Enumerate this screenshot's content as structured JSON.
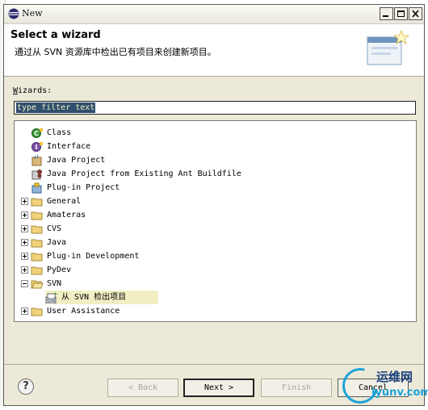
{
  "window": {
    "title": "New"
  },
  "header": {
    "title": "Select a wizard",
    "description": "通过从 SVN 资源库中检出已有项目来创建新项目。"
  },
  "wizards_label": {
    "mnemonic": "W",
    "rest": "izards:"
  },
  "filter": {
    "value": "type filter text"
  },
  "tree": {
    "items": [
      {
        "label": "Class",
        "icon": "class-icon",
        "kind": "leaf"
      },
      {
        "label": "Interface",
        "icon": "interface-icon",
        "kind": "leaf"
      },
      {
        "label": "Java Project",
        "icon": "java-project-icon",
        "kind": "leaf"
      },
      {
        "label": "Java Project from Existing Ant Buildfile",
        "icon": "ant-buildfile-icon",
        "kind": "leaf"
      },
      {
        "label": "Plug-in Project",
        "icon": "plugin-project-icon",
        "kind": "leaf"
      },
      {
        "label": "General",
        "icon": "folder-icon",
        "kind": "collapsed"
      },
      {
        "label": "Amateras",
        "icon": "folder-icon",
        "kind": "collapsed"
      },
      {
        "label": "CVS",
        "icon": "folder-icon",
        "kind": "collapsed"
      },
      {
        "label": "Java",
        "icon": "folder-icon",
        "kind": "collapsed"
      },
      {
        "label": "Plug-in Development",
        "icon": "folder-icon",
        "kind": "collapsed"
      },
      {
        "label": "PyDev",
        "icon": "folder-icon",
        "kind": "collapsed"
      },
      {
        "label": "SVN",
        "icon": "open-folder-icon",
        "kind": "expanded"
      },
      {
        "label": "从 SVN 检出项目",
        "icon": "svn-checkout-icon",
        "kind": "child",
        "selected": true
      },
      {
        "label": "User Assistance",
        "icon": "folder-icon",
        "kind": "collapsed"
      }
    ]
  },
  "buttons": {
    "back": "< Back",
    "next": "Next >",
    "finish": "Finish",
    "cancel": "Cancel"
  },
  "watermark": {
    "cn": "运维网",
    "en": "iyunv.com"
  }
}
